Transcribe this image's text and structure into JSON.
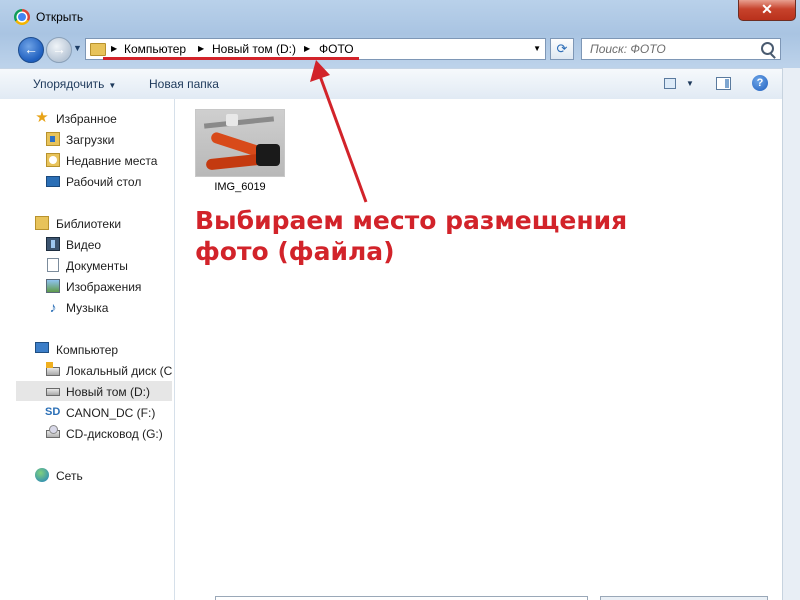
{
  "window": {
    "title": "Открыть",
    "close_glyph": "✕"
  },
  "navigation": {
    "back_glyph": "←",
    "forward_glyph": "→",
    "history_glyph": "▼",
    "breadcrumb": [
      "Компьютер",
      "Новый том (D:)",
      "ФОТО"
    ],
    "refresh_glyph": "⟳",
    "search_placeholder": "Поиск: ФОТО"
  },
  "toolbar": {
    "organize_label": "Упорядочить",
    "new_folder_label": "Новая папка",
    "help_glyph": "?"
  },
  "sidebar": {
    "favorites": {
      "header": "Избранное",
      "items": [
        "Загрузки",
        "Недавние места",
        "Рабочий стол"
      ]
    },
    "libraries": {
      "header": "Библиотеки",
      "items": [
        "Видео",
        "Документы",
        "Изображения",
        "Музыка"
      ]
    },
    "computer": {
      "header": "Компьютер",
      "items": [
        "Локальный диск (C",
        "Новый том (D:)",
        "CANON_DC (F:)",
        "CD-дисковод (G:)"
      ]
    },
    "network": {
      "header": "Сеть"
    },
    "icons": {
      "favorites": "star-icon",
      "music": "music-note-icon",
      "sd": "SD"
    }
  },
  "content": {
    "files": [
      {
        "name": "IMG_6019",
        "kind": "photo-thumbnail"
      }
    ]
  },
  "annotation": {
    "text_line1": "Выбираем место размещения",
    "text_line2": "фото (файла)",
    "color": "#d2232a"
  }
}
